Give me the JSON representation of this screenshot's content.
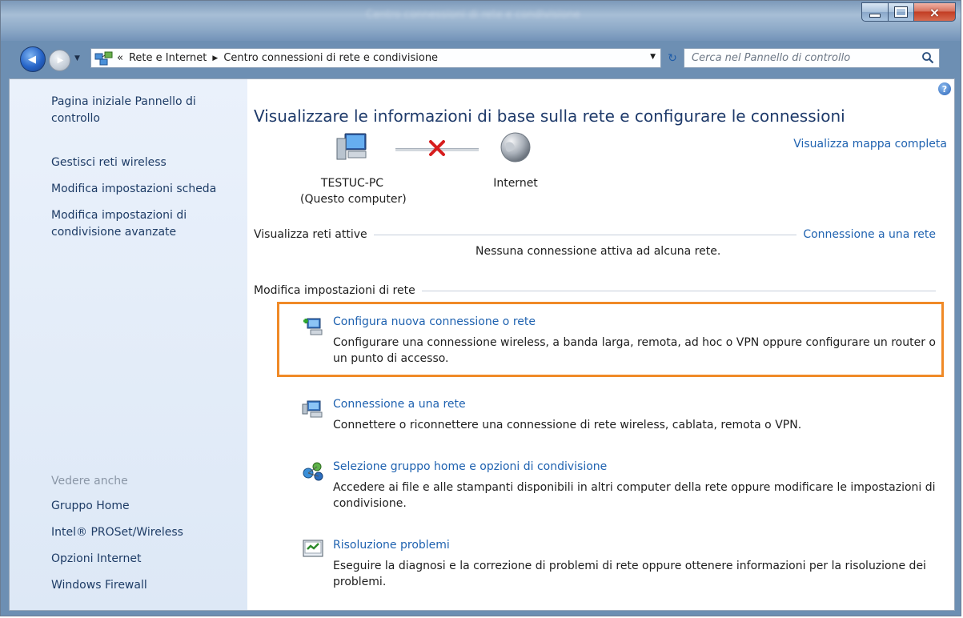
{
  "window": {
    "title": "Centro connessioni di rete e condivisione",
    "close_symbol": "×"
  },
  "nav": {
    "back_symbol": "◀",
    "forward_symbol": "▶",
    "breadcrumb_chevron": "«",
    "breadcrumbs": [
      "Rete e Internet",
      "Centro connessioni di rete e condivisione"
    ],
    "breadcrumb_separator": "▶",
    "dropdown_symbol": "▼",
    "refresh_symbol": "↻",
    "search_placeholder": "Cerca nel Pannello di controllo"
  },
  "sidebar": {
    "top_links": [
      "Pagina iniziale Pannello di controllo",
      "Gestisci reti wireless",
      "Modifica impostazioni scheda",
      "Modifica impostazioni di condivisione avanzate"
    ],
    "see_also_heading": "Vedere anche",
    "see_also_links": [
      "Gruppo Home",
      "Intel® PROSet/Wireless",
      "Opzioni Internet",
      "Windows Firewall"
    ]
  },
  "main": {
    "help_symbol": "?",
    "title": "Visualizzare le informazioni di base sulla rete e configurare le connessioni",
    "full_map_link": "Visualizza mappa completa",
    "computer_name": "TESTUC-PC",
    "computer_sub": "(Questo computer)",
    "internet_label": "Internet",
    "active_networks_heading": "Visualizza reti attive",
    "connect_link": "Connessione a una rete",
    "no_connection_text": "Nessuna connessione attiva ad alcuna rete.",
    "change_settings_heading": "Modifica impostazioni di rete",
    "tasks": [
      {
        "icon": "new-connection-icon",
        "title": "Configura nuova connessione o rete",
        "description": "Configurare una connessione wireless, a banda larga, remota, ad hoc o VPN oppure configurare un router o un punto di accesso."
      },
      {
        "icon": "connect-network-icon",
        "title": "Connessione a una rete",
        "description": "Connettere o riconnettere una connessione di rete wireless, cablata, remota o VPN."
      },
      {
        "icon": "homegroup-icon",
        "title": "Selezione gruppo home e opzioni di condivisione",
        "description": "Accedere ai file e alle stampanti disponibili in altri computer della rete oppure modificare le impostazioni di condivisione."
      },
      {
        "icon": "troubleshoot-icon",
        "title": "Risoluzione problemi",
        "description": "Eseguire la diagnosi e la correzione di problemi di rete oppure ottenere informazioni per la risoluzione dei problemi."
      }
    ]
  },
  "colors": {
    "link": "#1f62b0",
    "highlight": "#f08a27",
    "sidebar_bg": "#e4edf9"
  }
}
